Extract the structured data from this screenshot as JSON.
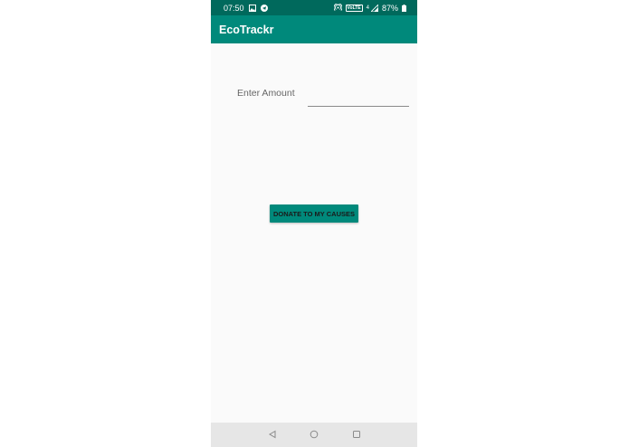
{
  "status_bar": {
    "time": "07:50",
    "network_badge": "VoLTE",
    "network_type": "4",
    "battery": "87%",
    "left_icons": [
      "image-icon",
      "telegram-icon"
    ],
    "right_icons": [
      "hotspot-icon",
      "volte-icon",
      "signal-icon",
      "battery-icon"
    ]
  },
  "app_bar": {
    "title": "EcoTrackr"
  },
  "form": {
    "amount_label": "Enter Amount",
    "amount_value": "",
    "donate_button_label": "DONATE TO MY CAUSES"
  },
  "nav_bar": {
    "buttons": [
      "back-icon",
      "home-icon",
      "recents-icon"
    ]
  },
  "colors": {
    "status_bar": "#00695c",
    "app_bar": "#00897b",
    "button": "#00897b",
    "background": "#fafafa",
    "nav_bar": "#e6e6e6"
  }
}
